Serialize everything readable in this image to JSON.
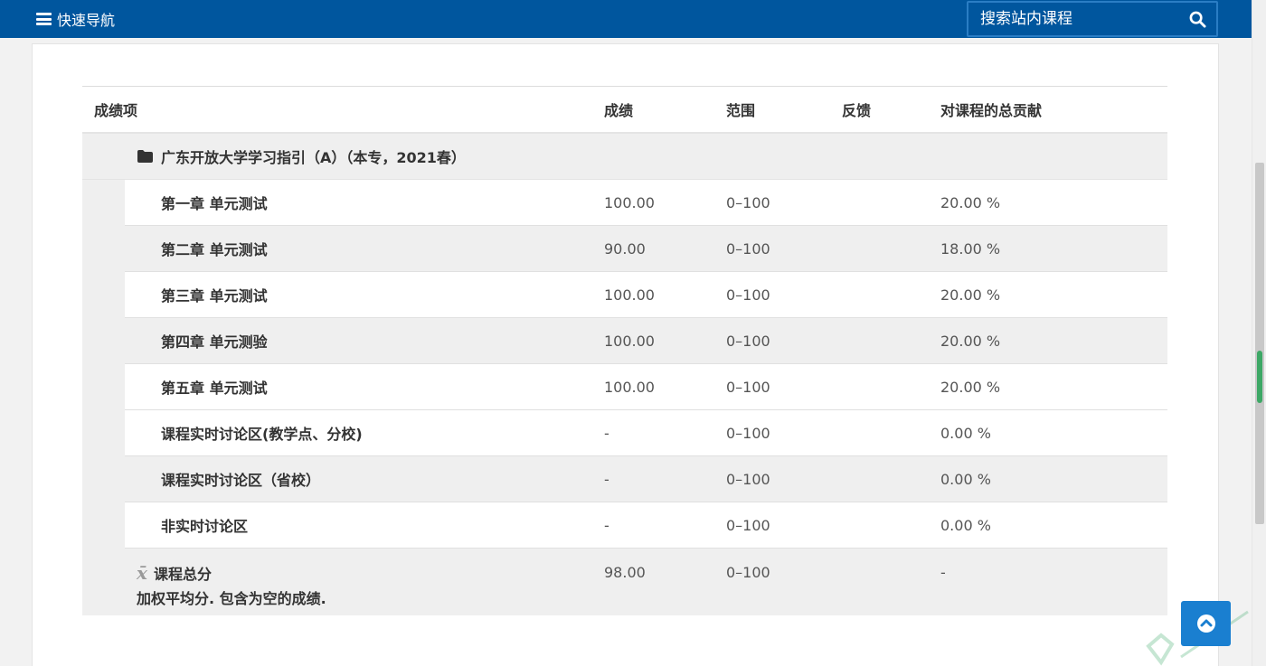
{
  "nav": {
    "toggle_label": "快速导航"
  },
  "search": {
    "placeholder": "搜索站内课程"
  },
  "table": {
    "headers": {
      "item": "成绩项",
      "grade": "成绩",
      "range": "范围",
      "feedback": "反馈",
      "contribution": "对课程的总贡献"
    },
    "category": "广东开放大学学习指引（A）（本专，2021春）",
    "rows": [
      {
        "item": "第一章 单元测试",
        "grade": "100.00",
        "range": "0–100",
        "feedback": "",
        "contribution": "20.00 %"
      },
      {
        "item": "第二章 单元测试",
        "grade": "90.00",
        "range": "0–100",
        "feedback": "",
        "contribution": "18.00 %"
      },
      {
        "item": "第三章 单元测试",
        "grade": "100.00",
        "range": "0–100",
        "feedback": "",
        "contribution": "20.00 %"
      },
      {
        "item": "第四章 单元测验",
        "grade": "100.00",
        "range": "0–100",
        "feedback": "",
        "contribution": "20.00 %"
      },
      {
        "item": "第五章 单元测试",
        "grade": "100.00",
        "range": "0–100",
        "feedback": "",
        "contribution": "20.00 %"
      },
      {
        "item": "课程实时讨论区(教学点、分校)",
        "grade": "-",
        "range": "0–100",
        "feedback": "",
        "contribution": "0.00 %"
      },
      {
        "item": "课程实时讨论区（省校）",
        "grade": "-",
        "range": "0–100",
        "feedback": "",
        "contribution": "0.00 %"
      },
      {
        "item": "非实时讨论区",
        "grade": "-",
        "range": "0–100",
        "feedback": "",
        "contribution": "0.00 %"
      }
    ],
    "total": {
      "item": "课程总分",
      "note": "加权平均分. 包含为空的成绩.",
      "grade": "98.00",
      "range": "0–100",
      "feedback": "",
      "contribution": "-"
    }
  },
  "colors": {
    "topbar": "#00569e",
    "accent": "#1a7fd0",
    "row_alt": "#efefef"
  },
  "icons": {
    "menu": "menu-icon",
    "search": "search-icon",
    "folder": "folder-icon",
    "mean": "mean-icon",
    "back_to_top": "chevron-up-icon"
  }
}
